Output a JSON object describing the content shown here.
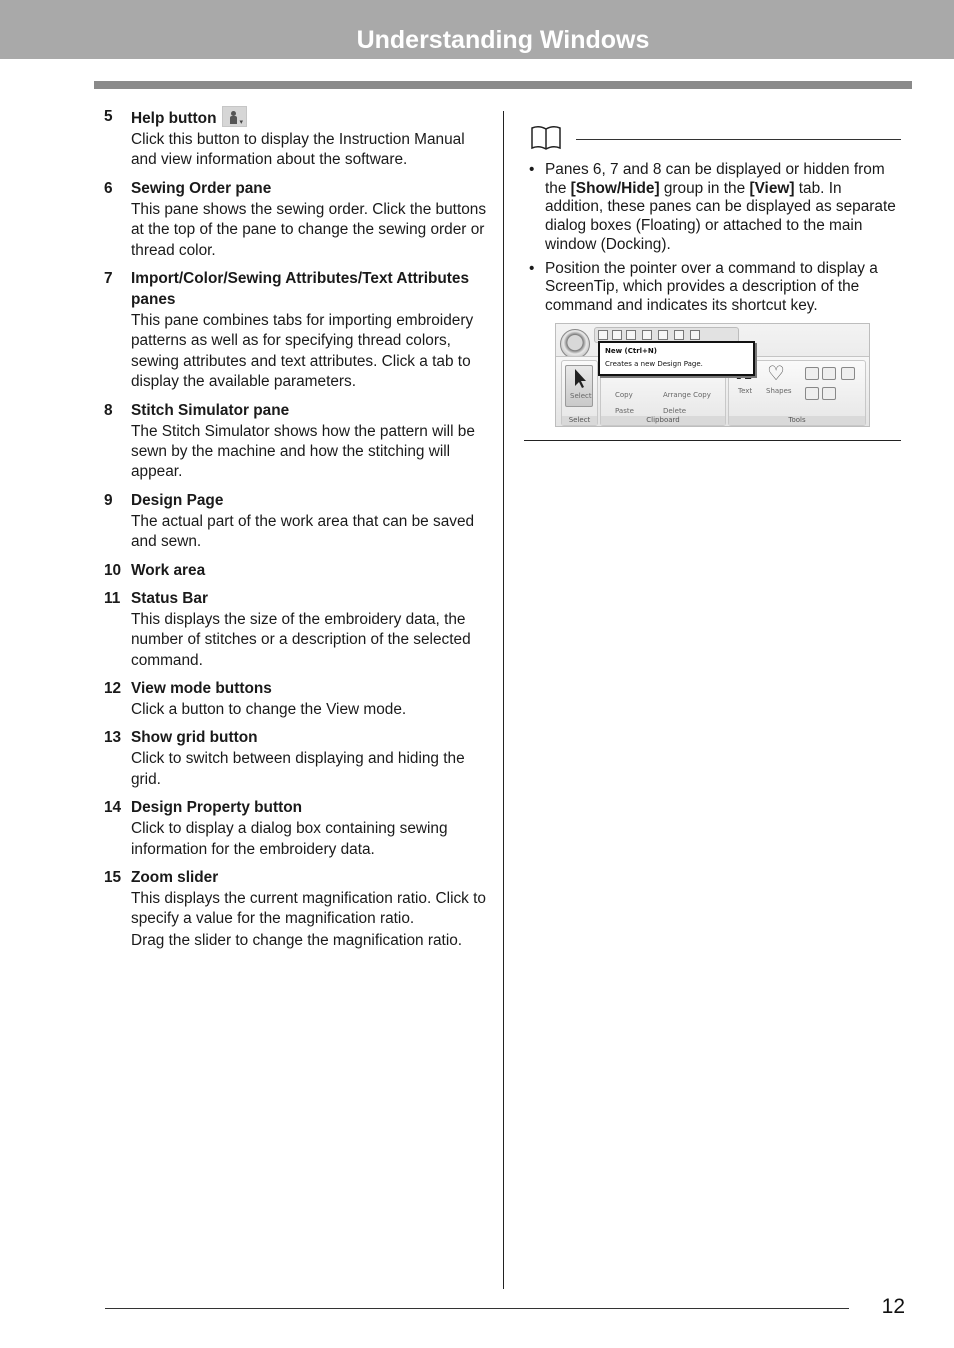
{
  "header": {
    "title": "Understanding Windows"
  },
  "entries": [
    {
      "num": "5",
      "title": "Help button",
      "icon": "help-person-icon",
      "body": "Click this button to display the Instruction Manual and view information about the software."
    },
    {
      "num": "6",
      "title": "Sewing Order pane",
      "body": "This pane shows the sewing order. Click the buttons at the top of the pane to change the sewing order or thread color."
    },
    {
      "num": "7",
      "title": "Import/Color/Sewing Attributes/Text Attributes panes",
      "body": "This pane combines tabs for importing embroidery patterns as well as for specifying thread colors, sewing attributes and text attributes. Click a tab to display the available parameters."
    },
    {
      "num": "8",
      "title": "Stitch Simulator pane",
      "body": "The Stitch Simulator shows how the pattern will be sewn by the machine and how the stitching will appear."
    },
    {
      "num": "9",
      "title": "Design Page",
      "body": "The actual part of the work area that can be saved and sewn."
    },
    {
      "num": "10",
      "title": "Work area",
      "body": ""
    },
    {
      "num": "11",
      "title": "Status Bar",
      "body": "This displays the size of the embroidery data, the number of stitches or a description of the selected command."
    },
    {
      "num": "12",
      "title": "View mode buttons",
      "body": "Click a button to change the View mode."
    },
    {
      "num": "13",
      "title": "Show grid button",
      "body": "Click to switch between displaying and hiding the grid."
    },
    {
      "num": "14",
      "title": "Design Property button",
      "body": "Click to display a dialog box containing sewing information for the embroidery data."
    },
    {
      "num": "15",
      "title": "Zoom slider",
      "body": "This displays the current magnification ratio. Click to specify a value for the magnification ratio.",
      "body2": "Drag the slider to change the magnification ratio."
    }
  ],
  "note": {
    "icon": "book-icon",
    "bullet_char": "•",
    "bullets": [
      {
        "pre": "Panes 6, 7 and 8 can be displayed or hidden from the ",
        "bold1": "[Show/Hide]",
        "mid": " group in the ",
        "bold2": "[View]",
        "post": " tab. In addition, these panes can be displayed as separate dialog boxes (Floating) or attached to the main window (Docking)."
      },
      {
        "text": "Position the pointer over a command to display a ScreenTip, which provides a description of the command and indicates its shortcut key."
      }
    ],
    "screenshot": {
      "tooltip_title": "New (Ctrl+N)",
      "tooltip_desc": "Creates a new Design Page.",
      "select_label": "Select",
      "copy_label": "Copy",
      "paste_label": "Paste",
      "arrange_copy_label": "Arrange Copy",
      "delete_label": "Delete",
      "text_label": "Text",
      "shapes_label": "Shapes",
      "group_select": "Select",
      "group_clipboard": "Clipboard",
      "group_tools": "Tools"
    }
  },
  "footer": {
    "page_number": "12"
  }
}
